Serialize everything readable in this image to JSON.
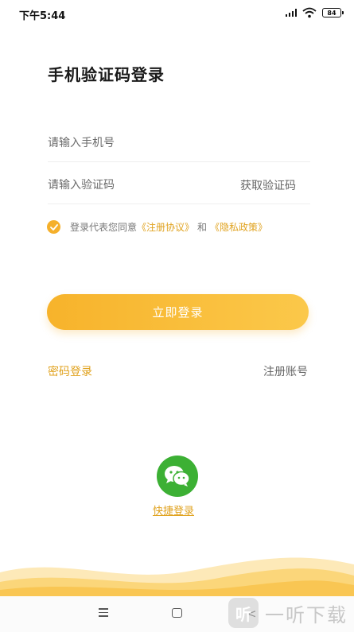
{
  "status_bar": {
    "time": "下午5:44",
    "battery": "84"
  },
  "login": {
    "title": "手机验证码登录",
    "phone_placeholder": "请输入手机号",
    "code_placeholder": "请输入验证码",
    "get_code_label": "获取验证码",
    "agreement": {
      "checked": true,
      "prefix": "登录代表您同意",
      "terms_link": "《注册协议》",
      "conjunction": "和",
      "privacy_link": "《隐私政策》"
    },
    "submit_label": "立即登录",
    "password_login_label": "密码登录",
    "register_label": "注册账号",
    "quick_login_label": "快捷登录"
  },
  "watermark": {
    "logo_text": "听",
    "text": "一听下载"
  },
  "colors": {
    "accent": "#f5b02b",
    "wechat": "#3cb034",
    "link": "#e0a21e"
  }
}
